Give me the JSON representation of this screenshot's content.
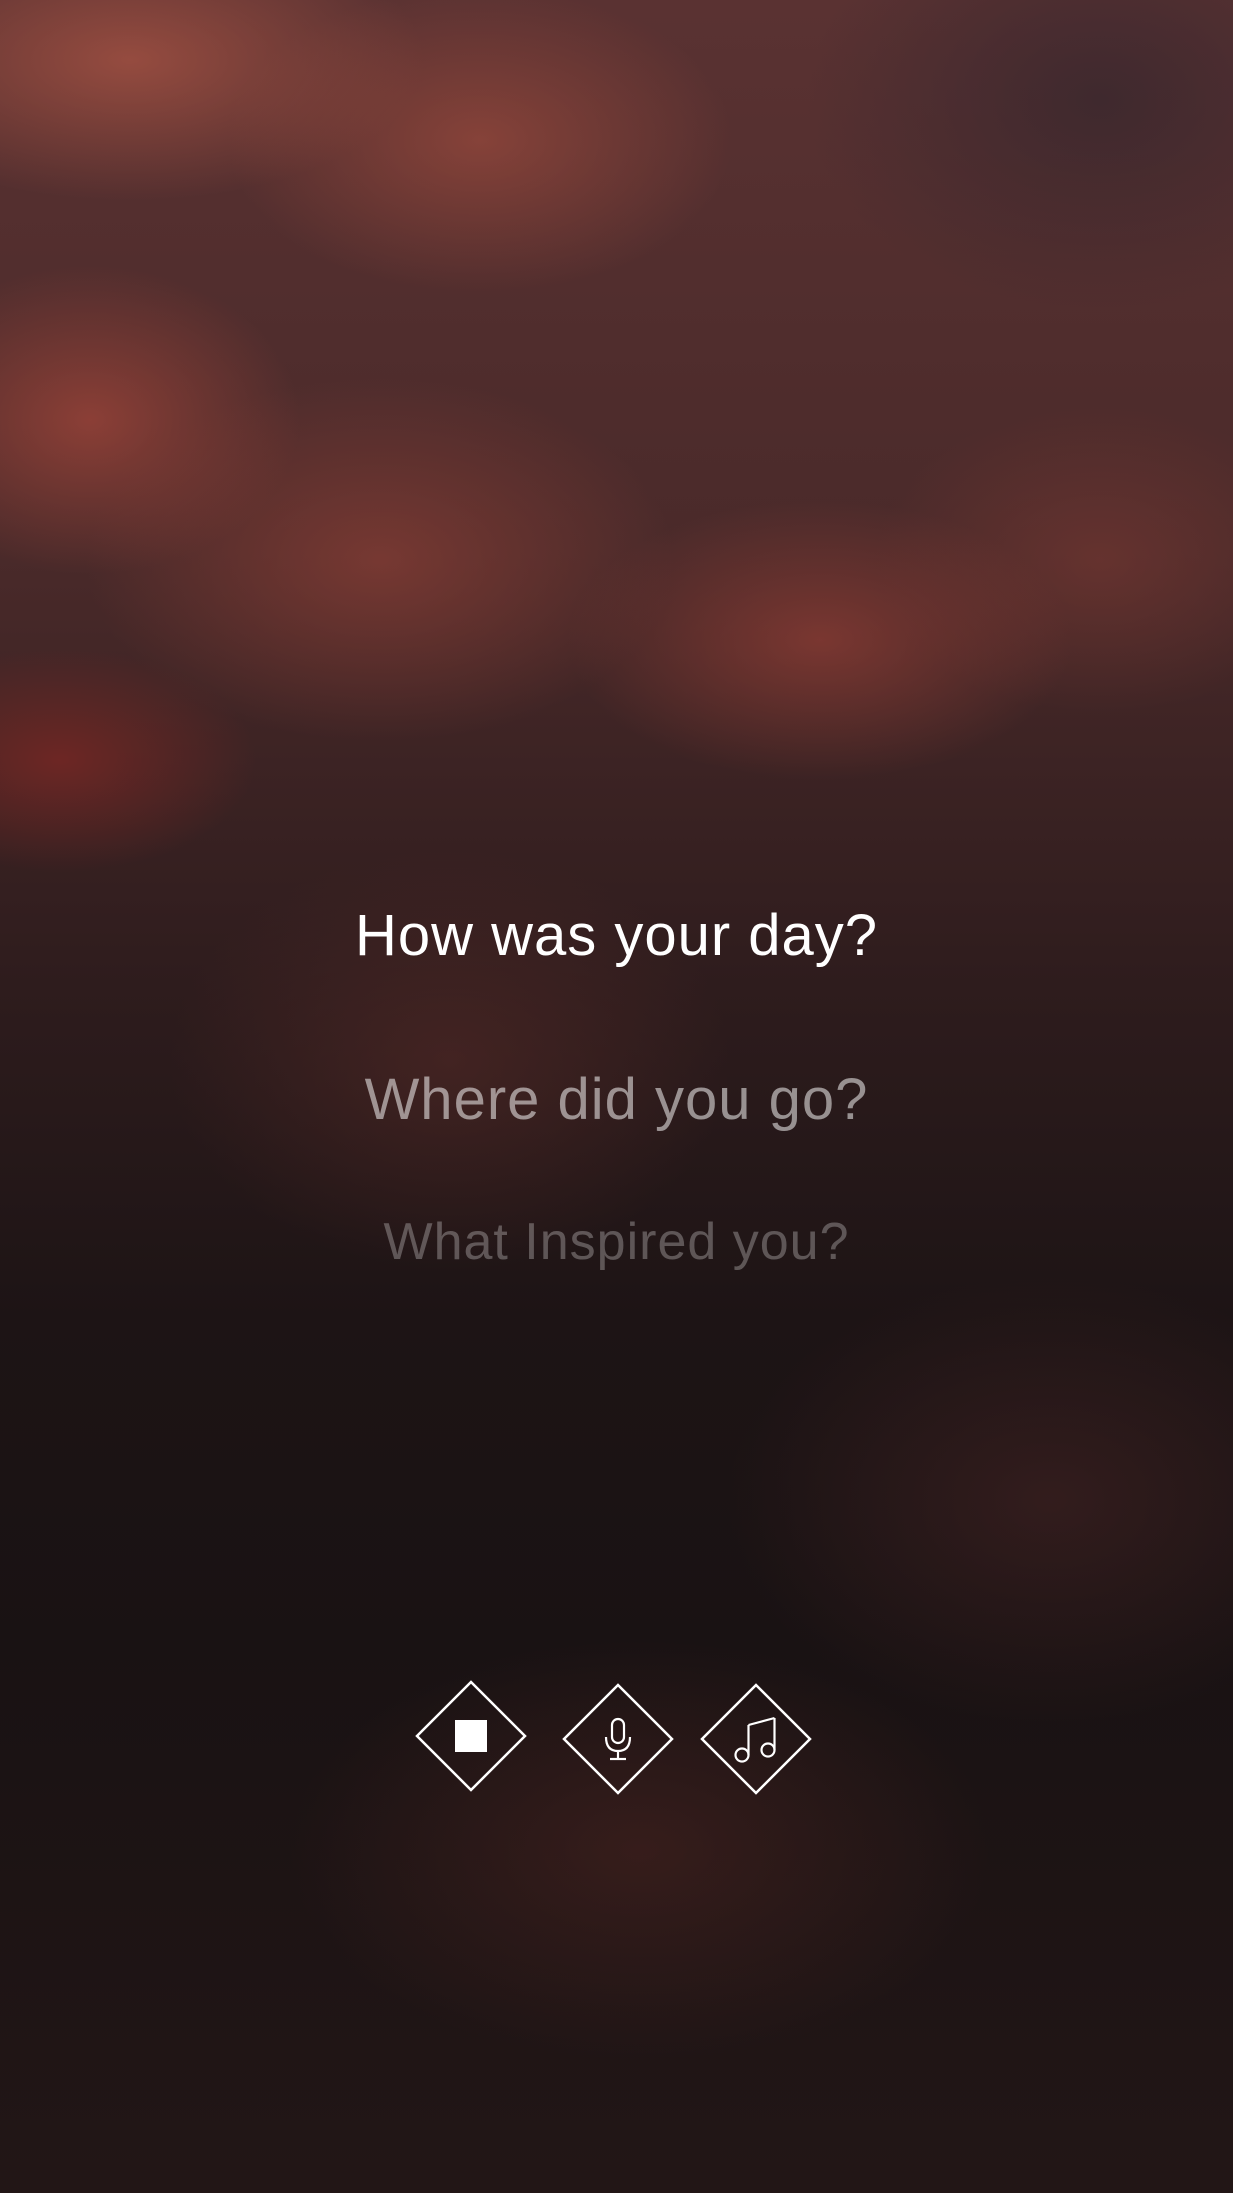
{
  "prompts": {
    "current": "How was your day?",
    "next": "Where did you go?",
    "later": "What Inspired you?"
  },
  "controls": {
    "stop_icon": "stop-icon",
    "mic_icon": "microphone-icon",
    "music_icon": "music-note-icon"
  },
  "colors": {
    "background_top": "#5a3232",
    "background_bottom": "#1a1213",
    "text_primary": "#ffffff",
    "icon_stroke": "#ffffff"
  }
}
